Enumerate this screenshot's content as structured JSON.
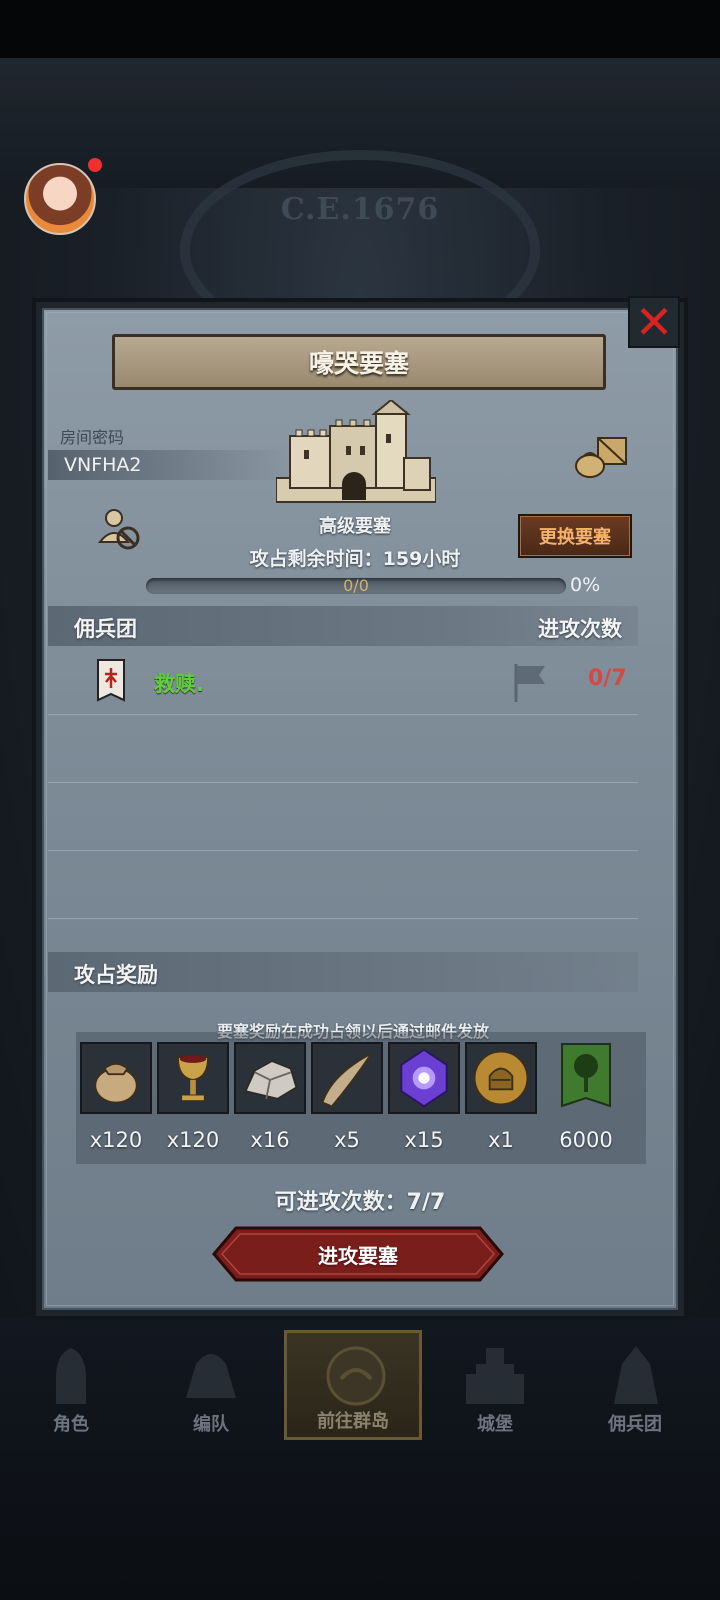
{
  "background": {
    "year": "C.E.1676"
  },
  "modal": {
    "title": "嚎哭要塞",
    "room": {
      "label": "房间密码",
      "code": "VNFHA2"
    },
    "fortress": {
      "name": "高级要塞",
      "change_button": "更换要塞"
    },
    "time_left": "攻占剩余时间：159小时",
    "progress": {
      "text": "0/0",
      "percent": "0%",
      "fill_fraction": 0
    },
    "mercenary_section": {
      "title": "佣兵团",
      "right_title": "进攻次数"
    },
    "guilds": [
      {
        "name": "救赎.",
        "attack_count": "0/7"
      }
    ],
    "rewards_section": {
      "title": "攻占奖励",
      "note": "要塞奖励在成功占领以后通过邮件发放",
      "items": [
        {
          "icon": "sack-icon",
          "qty": "x120"
        },
        {
          "icon": "goblet-icon",
          "qty": "x120"
        },
        {
          "icon": "ore-icon",
          "qty": "x16"
        },
        {
          "icon": "horn-icon",
          "qty": "x5"
        },
        {
          "icon": "purple-crystal-icon",
          "qty": "x15"
        },
        {
          "icon": "helmet-medal-icon",
          "qty": "x1"
        },
        {
          "icon": "tree-banner-icon",
          "qty": "6000"
        }
      ]
    },
    "attack_times": "可进攻次数：7/7",
    "attack_button": "进攻要塞"
  },
  "nav": [
    {
      "label": "角色",
      "icon": "knight-icon",
      "active": false
    },
    {
      "label": "编队",
      "icon": "helmet-icon",
      "active": false
    },
    {
      "label": "前往群岛",
      "icon": "islands-icon",
      "active": true
    },
    {
      "label": "城堡",
      "icon": "castle-icon",
      "active": false
    },
    {
      "label": "佣兵团",
      "icon": "mercenary-icon",
      "active": false
    }
  ],
  "colors": {
    "guild_name": "#5fcf3d",
    "attack_count": "#d34a45",
    "close": "#d8231f",
    "button_red": "#7a1e1c"
  }
}
